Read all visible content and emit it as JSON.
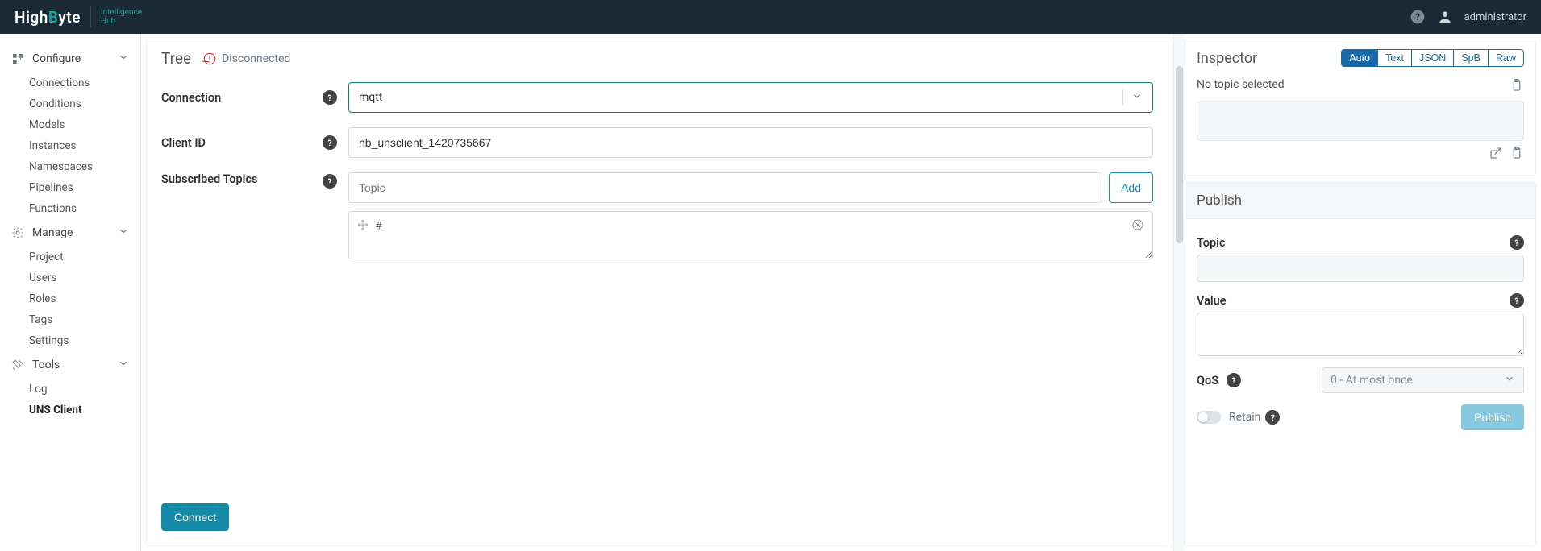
{
  "brand": {
    "name_pre": "High",
    "name_accent_char": "B",
    "name_post": "yte",
    "sub_line1": "Intelligence",
    "sub_line2": "Hub"
  },
  "header": {
    "user": "administrator"
  },
  "sidebar": {
    "groups": [
      {
        "label": "Configure",
        "items": [
          "Connections",
          "Conditions",
          "Models",
          "Instances",
          "Namespaces",
          "Pipelines",
          "Functions"
        ]
      },
      {
        "label": "Manage",
        "items": [
          "Project",
          "Users",
          "Roles",
          "Tags",
          "Settings"
        ]
      },
      {
        "label": "Tools",
        "items": [
          "Log",
          "UNS Client"
        ],
        "active_index": 1
      }
    ]
  },
  "tree": {
    "title": "Tree",
    "status": "Disconnected",
    "labels": {
      "connection": "Connection",
      "client_id": "Client ID",
      "subscribed": "Subscribed Topics"
    },
    "connection_value": "mqtt",
    "client_id_value": "hb_unsclient_1420735667",
    "topic_placeholder": "Topic",
    "add_label": "Add",
    "topics": [
      "#"
    ],
    "connect_label": "Connect"
  },
  "inspector": {
    "title": "Inspector",
    "tabs": [
      "Auto",
      "Text",
      "JSON",
      "SpB",
      "Raw"
    ],
    "active_tab": 0,
    "empty_msg": "No topic selected"
  },
  "publish": {
    "title": "Publish",
    "labels": {
      "topic": "Topic",
      "value": "Value",
      "qos": "QoS",
      "retain": "Retain"
    },
    "qos_value": "0 - At most once",
    "button": "Publish"
  }
}
